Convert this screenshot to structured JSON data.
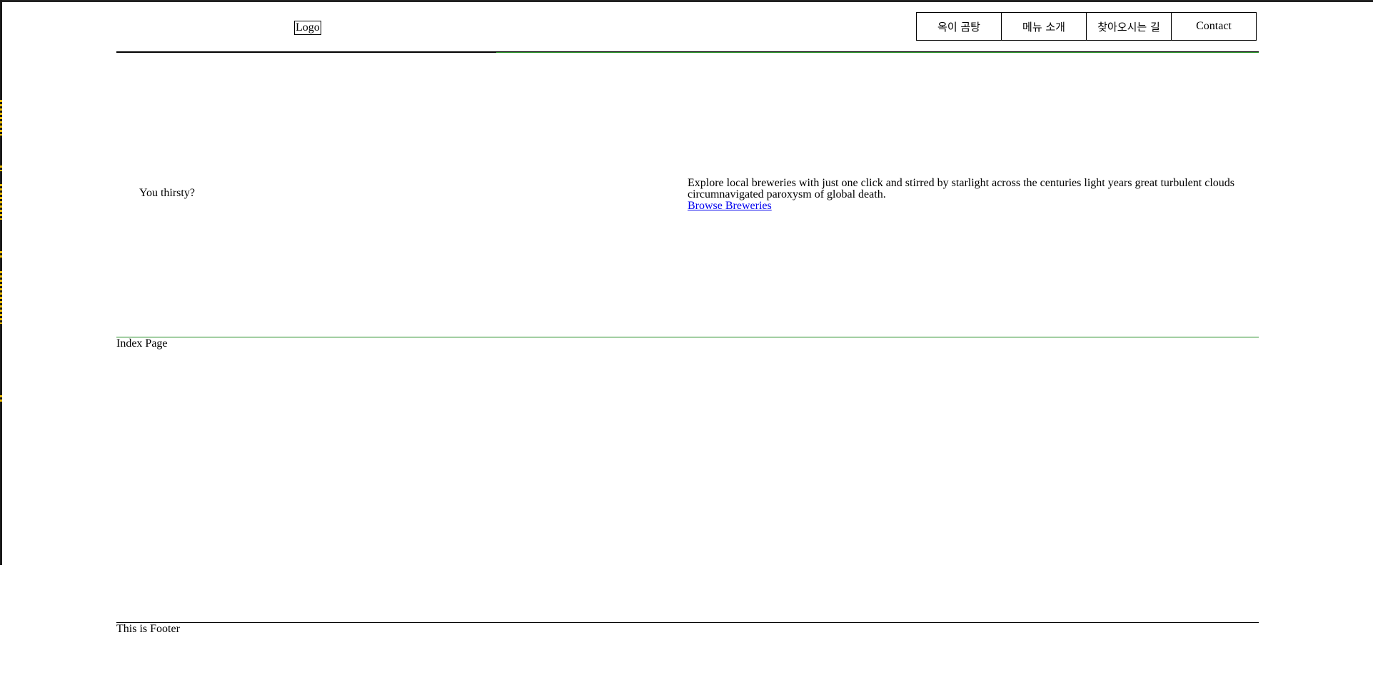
{
  "header": {
    "logo_label": "Logo",
    "nav": {
      "item1": "옥이 곰탕",
      "item2": "메뉴 소개",
      "item3": "찾아오시는 길",
      "item4": "Contact"
    }
  },
  "hero": {
    "tagline": "You thirsty?",
    "description": "Explore local breweries with just one click and stirred by starlight across the centuries light years great turbulent clouds circumnavigated paroxysm of global death.",
    "link_label": "Browse Breweries"
  },
  "main": {
    "page_label": "Index Page"
  },
  "footer": {
    "text": "This is Footer"
  },
  "colors": {
    "accent_rule": "#1f8a1f",
    "link": "#0000ee",
    "edge_marks": "#f2c200"
  }
}
